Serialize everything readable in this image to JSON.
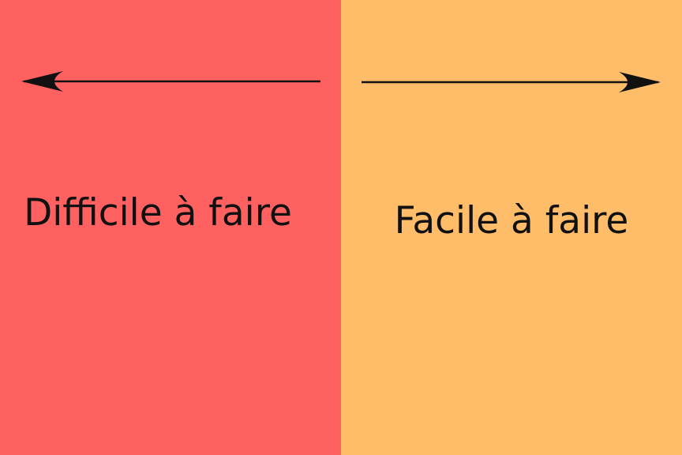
{
  "panels": {
    "left": {
      "label": "Difficile à faire",
      "color": "#FF6161",
      "arrow_direction": "left"
    },
    "right": {
      "label": "Facile à faire",
      "color": "#FFBC69",
      "arrow_direction": "right"
    }
  },
  "colors": {
    "arrow": "#111111",
    "text": "#111111"
  },
  "icons": {
    "left_arrow": "arrow-left-icon",
    "right_arrow": "arrow-right-icon"
  }
}
